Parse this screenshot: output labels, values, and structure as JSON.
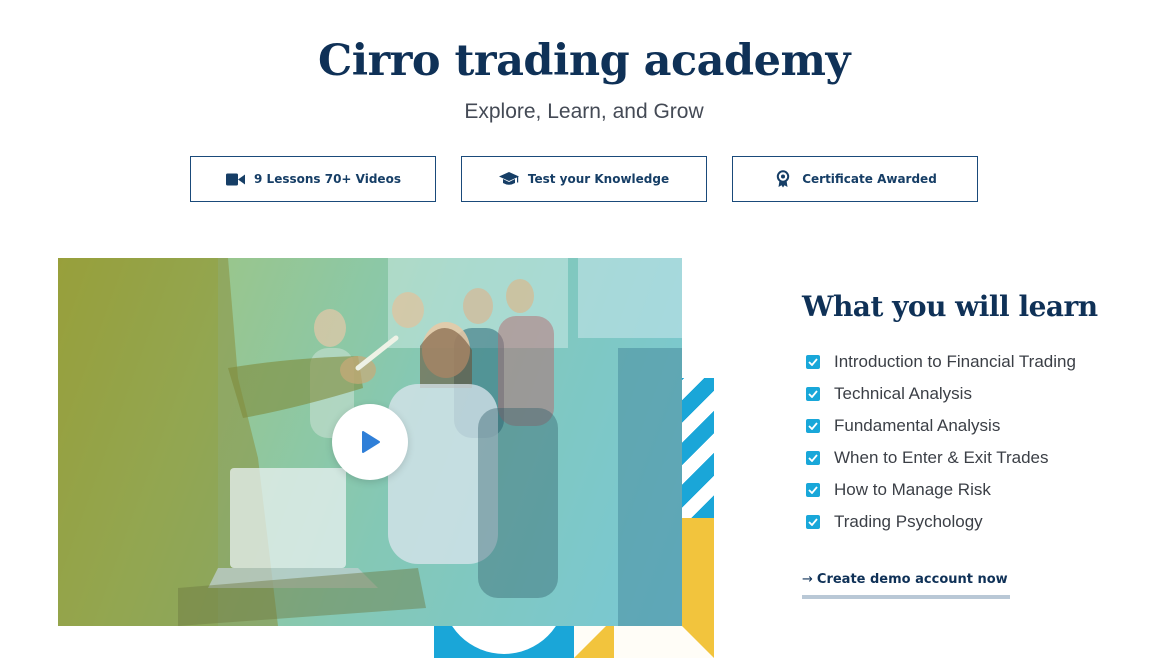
{
  "header": {
    "title": "Cirro trading academy",
    "subtitle": "Explore, Learn, and Grow"
  },
  "features": [
    {
      "label": "9 Lessons 70+ Videos",
      "icon": "video-camera-icon"
    },
    {
      "label": "Test your Knowledge",
      "icon": "graduation-cap-icon"
    },
    {
      "label": "Certificate Awarded",
      "icon": "award-ribbon-icon"
    }
  ],
  "video": {
    "play_icon": "play-icon",
    "overlay_colors": [
      "#a8b23a",
      "#6cc3d6"
    ]
  },
  "learn": {
    "title": "What you will learn",
    "items": [
      "Introduction to Financial Trading",
      "Technical Analysis",
      "Fundamental Analysis",
      "When to Enter & Exit Trades",
      "How to Manage Risk",
      "Trading Psychology"
    ]
  },
  "cta": {
    "arrow": "→",
    "label": "Create demo account now"
  },
  "colors": {
    "brand_navy": "#0f3157",
    "accent_blue": "#19a7d9",
    "accent_yellow": "#f2c43d"
  }
}
